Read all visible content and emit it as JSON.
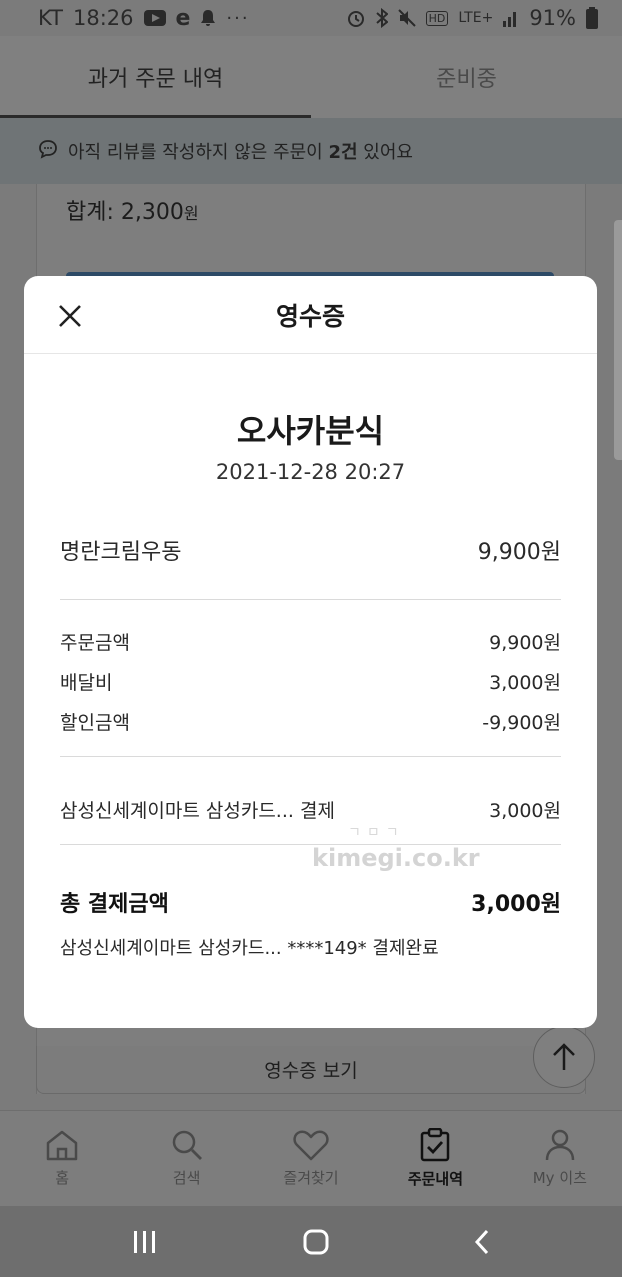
{
  "status_bar": {
    "carrier": "KT",
    "time": "18:26",
    "battery": "91%",
    "network": "LTE+"
  },
  "tabs": [
    {
      "label": "과거 주문 내역",
      "active": true
    },
    {
      "label": "준비중",
      "active": false
    }
  ],
  "banner": {
    "text_before": "아직 리뷰를 작성하지 않은 주문이 ",
    "count": "2건",
    "text_after": " 있어요"
  },
  "background": {
    "total_label": "합계: 2,300",
    "total_unit": "원",
    "receipt_button": "영수증 보기"
  },
  "modal": {
    "title": "영수증",
    "store": "오사카분식",
    "date": "2021-12-28 20:27",
    "item": {
      "name": "명란크림우동",
      "price": "9,900원"
    },
    "summary": [
      {
        "label": "주문금액",
        "value": "9,900원"
      },
      {
        "label": "배달비",
        "value": "3,000원"
      },
      {
        "label": "할인금액",
        "value": "-9,900원"
      }
    ],
    "payment": {
      "label": "삼성신세계이마트 삼성카드... 결제",
      "value": "3,000원"
    },
    "total": {
      "label": "총 결제금액",
      "value": "3,000원"
    },
    "payment_detail": "삼성신세계이마트 삼성카드... ****149* 결제완료"
  },
  "watermark": {
    "top": "ㄱㅁㄱ",
    "text": "kimegi.co.kr"
  },
  "bottom_nav": [
    {
      "label": "홈",
      "icon": "home-icon",
      "active": false
    },
    {
      "label": "검색",
      "icon": "search-icon",
      "active": false
    },
    {
      "label": "즐겨찾기",
      "icon": "heart-icon",
      "active": false
    },
    {
      "label": "주문내역",
      "icon": "clipboard-check-icon",
      "active": true
    },
    {
      "label": "My 이츠",
      "icon": "person-icon",
      "active": false
    }
  ]
}
